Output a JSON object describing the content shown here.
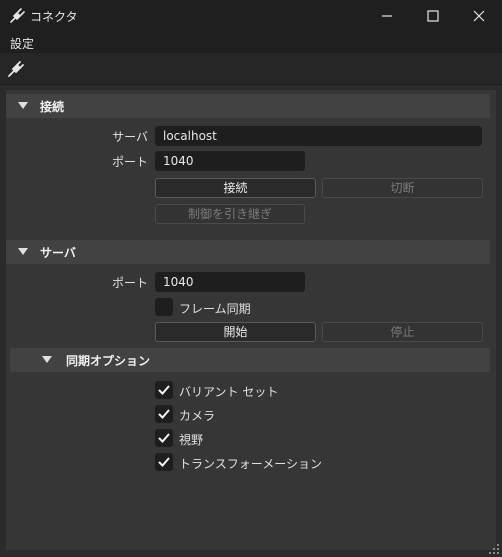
{
  "window": {
    "title": "コネクタ",
    "minimize_icon": "minimize-icon",
    "maximize_icon": "maximize-icon",
    "close_icon": "close-icon"
  },
  "menu": {
    "items": [
      "設定"
    ]
  },
  "toolbar": {
    "icon": "plug-icon"
  },
  "connection": {
    "header": "接続",
    "server_label": "サーバ",
    "server_value": "localhost",
    "port_label": "ポート",
    "port_value": "1040",
    "connect_button": "接続",
    "disconnect_button": "切断",
    "takeover_button": "制御を引き継ぎ"
  },
  "server": {
    "header": "サーバ",
    "port_label": "ポート",
    "port_value": "1040",
    "frame_sync_label": "フレーム同期",
    "frame_sync_checked": false,
    "start_button": "開始",
    "stop_button": "停止"
  },
  "sync_options": {
    "header": "同期オプション",
    "items": [
      {
        "label": "バリアント セット",
        "checked": true
      },
      {
        "label": "カメラ",
        "checked": true
      },
      {
        "label": "視野",
        "checked": true
      },
      {
        "label": "トランスフォーメーション",
        "checked": true
      }
    ]
  },
  "colors": {
    "background": "#2b2b2b",
    "titlebar": "#1f1f1f",
    "panel": "#363636",
    "section_header": "#424242",
    "field": "#1e1e1e"
  }
}
